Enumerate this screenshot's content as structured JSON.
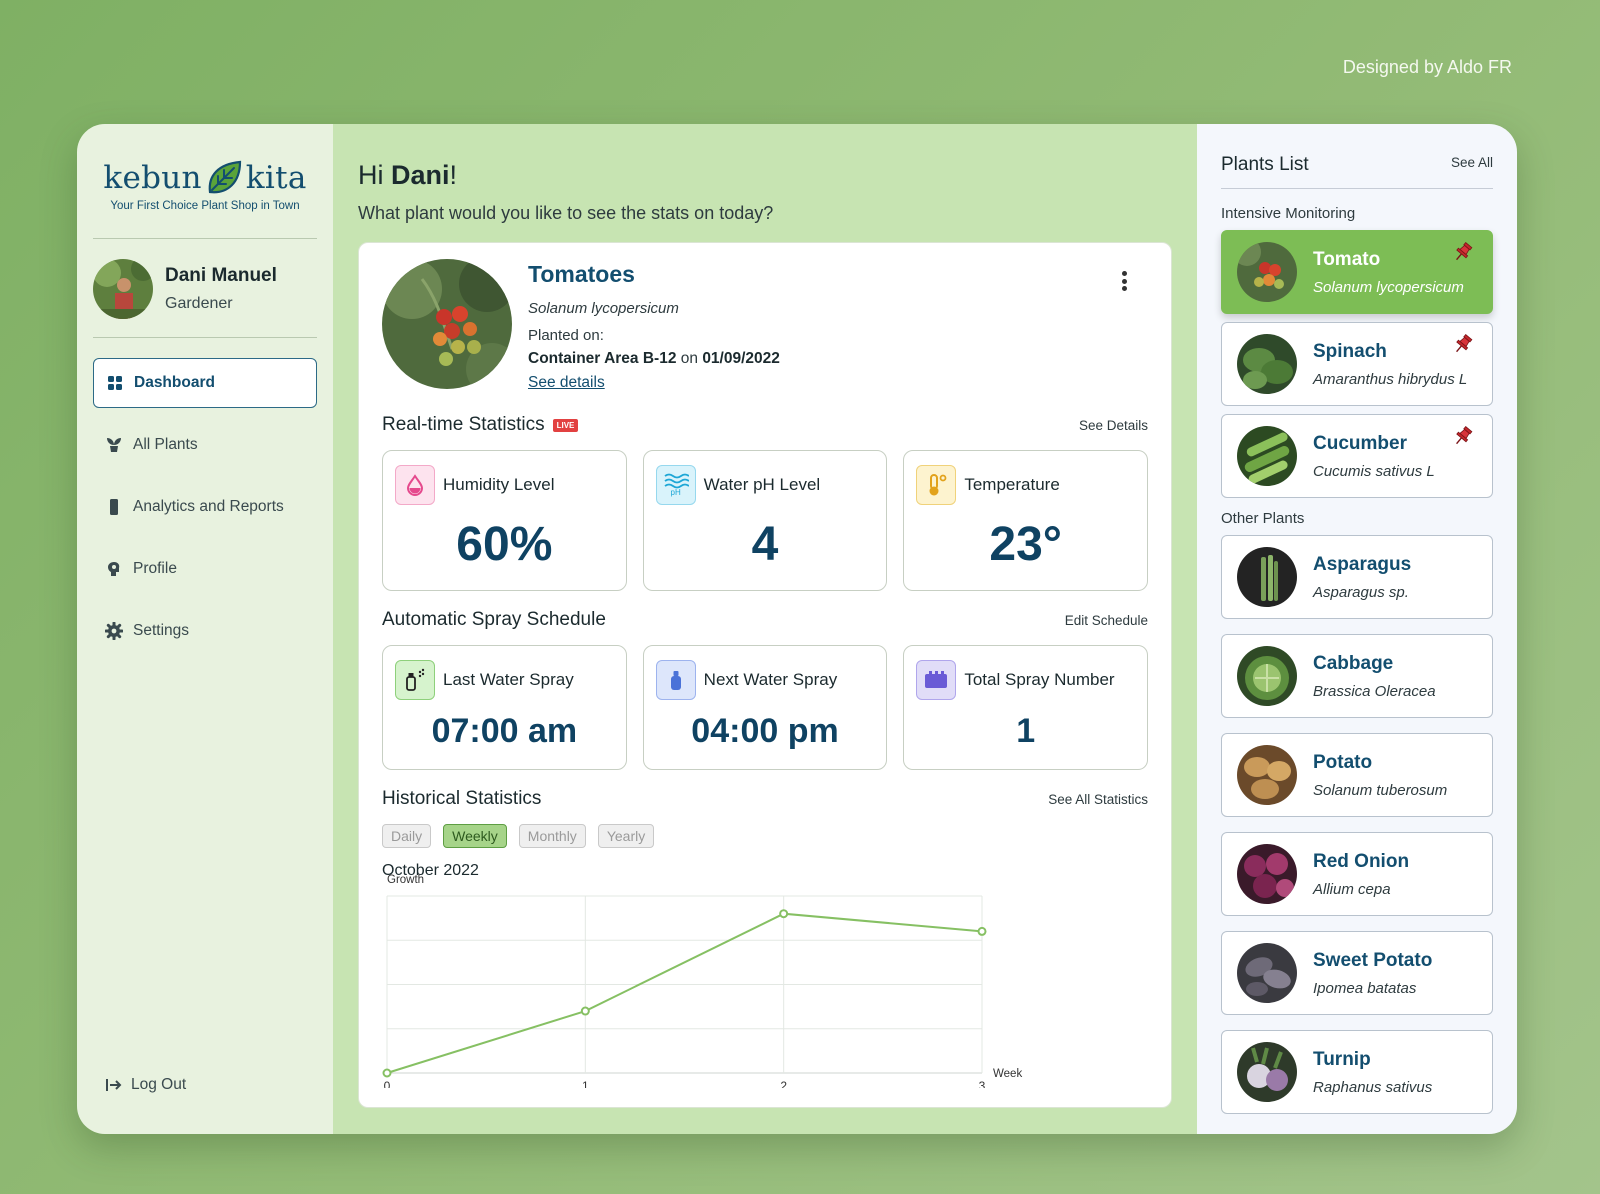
{
  "credit": "Designed by Aldo FR",
  "brand": {
    "word_left": "kebun",
    "word_right": "kita",
    "tagline": "Your First Choice Plant Shop in Town"
  },
  "user": {
    "name": "Dani Manuel",
    "role": "Gardener"
  },
  "nav": [
    {
      "label": "Dashboard",
      "icon": "grid-icon",
      "active": true
    },
    {
      "label": "All Plants",
      "icon": "plant-pot-icon"
    },
    {
      "label": "Analytics and Reports",
      "icon": "phone-icon"
    },
    {
      "label": "Profile",
      "icon": "head-icon"
    },
    {
      "label": "Settings",
      "icon": "gear-icon"
    }
  ],
  "logout": "Log Out",
  "greeting": {
    "hi": "Hi ",
    "name": "Dani",
    "suffix": "!",
    "question": "What plant would you like to see the stats on today?"
  },
  "plant": {
    "name": "Tomatoes",
    "scientific": "Solanum lycopersicum",
    "planted_label": "Planted on:",
    "location": "Container Area B-12",
    "on": " on ",
    "date": "01/09/2022",
    "details_link": "See details"
  },
  "realtime": {
    "title": "Real-time Statistics",
    "live": "LIVE",
    "link": "See Details",
    "stats": [
      {
        "label": "Humidity Level",
        "value": "60%",
        "icon": "droplet-icon",
        "bg": "#fde3ee",
        "fg": "#e5498d"
      },
      {
        "label": "Water pH Level",
        "value": "4",
        "icon": "water-ph-icon",
        "icon_text": "pH",
        "bg": "#d9f3fb",
        "fg": "#1ea7d6"
      },
      {
        "label": "Temperature",
        "value": "23°",
        "icon": "thermometer-icon",
        "bg": "#fdf3cf",
        "fg": "#e2a21b"
      }
    ]
  },
  "spray": {
    "title": "Automatic Spray Schedule",
    "link": "Edit Schedule",
    "stats": [
      {
        "label": "Last Water Spray",
        "value": "07:00 am",
        "icon": "spray-bottle-icon",
        "bg": "#d6f3cd",
        "fg": "#3f9e2d"
      },
      {
        "label": "Next Water Spray",
        "value": "04:00 pm",
        "icon": "bottle-icon",
        "bg": "#dde6fb",
        "fg": "#4a72d8"
      },
      {
        "label": "Total Spray Number",
        "value": "1",
        "icon": "counter-icon",
        "bg": "#e1ddf8",
        "fg": "#6a5bd6"
      }
    ]
  },
  "history": {
    "title": "Historical Statistics",
    "link": "See All Statistics",
    "tabs": [
      "Daily",
      "Weekly",
      "Monthly",
      "Yearly"
    ],
    "active_tab": "Weekly",
    "month": "October 2022"
  },
  "chart_data": {
    "type": "line",
    "x": [
      0,
      1,
      2,
      3
    ],
    "values": [
      0,
      14,
      36,
      32
    ],
    "ylabel": "Growth",
    "xlabel": "Week",
    "xlim": [
      0,
      3
    ],
    "ylim": [
      0,
      40
    ],
    "grid": true,
    "color": "#86c063"
  },
  "plants_list": {
    "title": "Plants List",
    "see_all": "See All",
    "intensive_label": "Intensive Monitoring",
    "other_label": "Other Plants",
    "intensive": [
      {
        "name": "Tomato",
        "sci": "Solanum lycopersicum",
        "active": true
      },
      {
        "name": "Spinach",
        "sci": "Amaranthus hibrydus L"
      },
      {
        "name": "Cucumber",
        "sci": "Cucumis sativus L"
      }
    ],
    "other": [
      {
        "name": "Asparagus",
        "sci": "Asparagus sp."
      },
      {
        "name": "Cabbage",
        "sci": "Brassica Oleracea"
      },
      {
        "name": "Potato",
        "sci": "Solanum tuberosum"
      },
      {
        "name": "Red Onion",
        "sci": "Allium cepa"
      },
      {
        "name": "Sweet Potato",
        "sci": "Ipomea batatas"
      },
      {
        "name": "Turnip",
        "sci": "Raphanus sativus"
      }
    ]
  }
}
